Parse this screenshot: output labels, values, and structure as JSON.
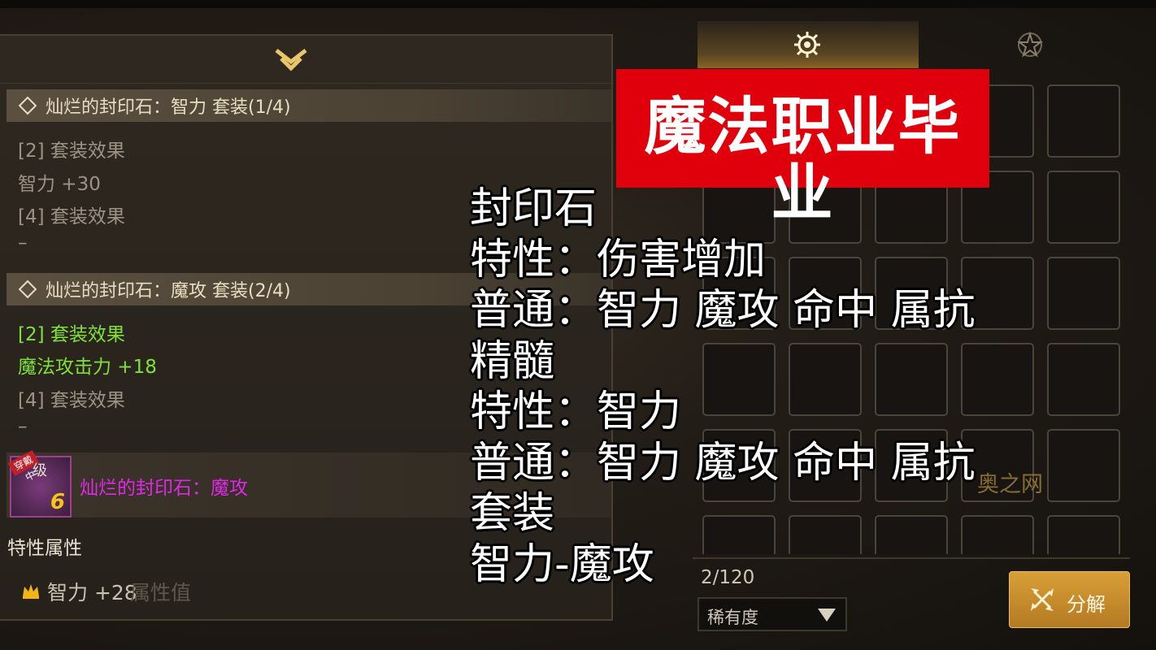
{
  "left_panel": {
    "set1": {
      "header": "灿烂的封印石：智力 套装(1/4)",
      "lines": [
        "[2] 套装效果",
        "智力 +30",
        "[4] 套装效果",
        "–"
      ]
    },
    "set2": {
      "header": "灿烂的封印石：魔攻 套装(2/4)",
      "lines_active": [
        "[2] 套装效果",
        "魔法攻击力 +18"
      ],
      "lines": [
        "[4] 套装效果",
        "–"
      ]
    },
    "item": {
      "badge": "穿戴中",
      "level_text": "级",
      "level_number": "6",
      "name": "灿烂的封印石：魔攻"
    },
    "property_title": "特性属性",
    "property_value": "智力 +28",
    "property_ghost": "属性值"
  },
  "right_panel": {
    "tabs": [
      {
        "icon": "sun-gear-icon",
        "active": true
      },
      {
        "icon": "star-icon",
        "active": false
      }
    ],
    "inventory_count": "2/120",
    "sort_dropdown": "稀有度",
    "decompose_button": "分解"
  },
  "overlay": {
    "banner": "魔法职业毕业",
    "lines": [
      "封印石",
      "特性：伤害增加",
      "普通：智力 魔攻 命中 属抗",
      "精髓",
      "特性：智力",
      "普通：智力 魔攻 命中 属抗",
      "套装",
      "智力-魔攻"
    ],
    "watermark": "奥之网"
  },
  "colors": {
    "set_header_text": "#e9ddc1",
    "active_effect_green": "#7fe23a",
    "item_name_magenta": "#e028e8",
    "banner_red": "#e0000b",
    "button_gold": "#d89f37"
  }
}
